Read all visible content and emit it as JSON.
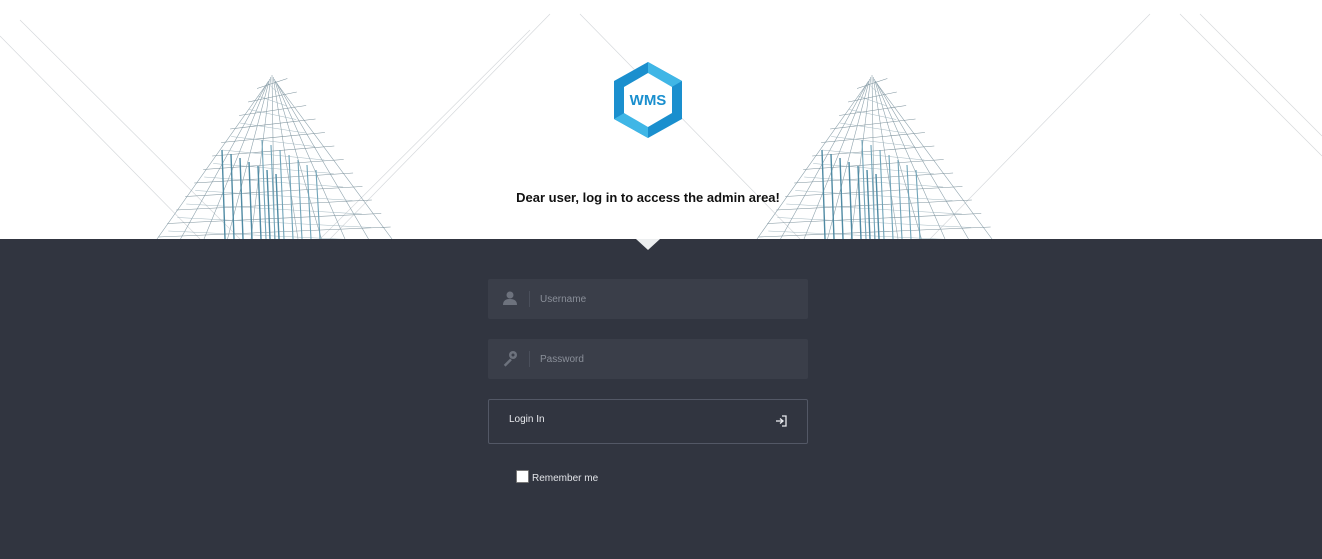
{
  "logo": {
    "text": "WMS",
    "primary_color": "#1a8fce",
    "accent_color": "#3fb6e6"
  },
  "tagline": "Dear user, log in to access the admin area!",
  "form": {
    "username": {
      "placeholder": "Username",
      "value": "",
      "icon": "user-icon"
    },
    "password": {
      "placeholder": "Password",
      "value": "",
      "icon": "key-icon"
    },
    "login_button": {
      "label": "Login In",
      "icon": "sign-in-icon"
    },
    "remember_me": {
      "label": "Remember me",
      "checked": false
    }
  },
  "colors": {
    "panel_bg": "#313540",
    "field_bg": "#3a3e49",
    "header_bg": "#ffffff"
  }
}
